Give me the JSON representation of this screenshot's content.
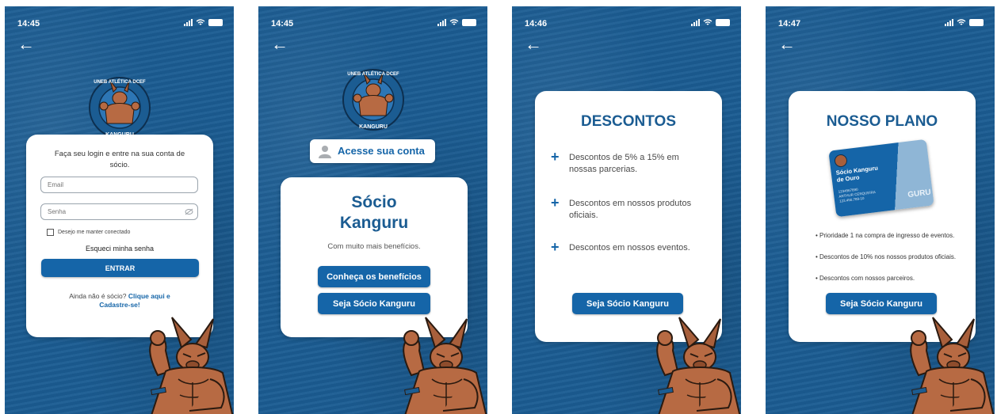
{
  "screens": [
    {
      "time": "14:45",
      "login": {
        "intro": "Faça seu login e entre na sua conta de sócio.",
        "email_placeholder": "Email",
        "password_placeholder": "Senha",
        "remember_label": "Desejo me manter conectado",
        "forgot_label": "Esqueci minha senha",
        "enter_label": "ENTRAR",
        "signup_prefix": "Ainda não é sócio?",
        "signup_link": "Clique aqui e Cadastre-se!"
      }
    },
    {
      "time": "14:45",
      "account_button": "Acesse sua conta",
      "title_line1": "Sócio",
      "title_line2": "Kanguru",
      "subtitle": "Com muito mais benefícios.",
      "benefits_button": "Conheça os benefícios",
      "join_button": "Seja Sócio Kanguru"
    },
    {
      "time": "14:46",
      "title": "DESCONTOS",
      "items": [
        "Descontos de 5% a 15% em nossas parcerias.",
        "Descontos em nossos produtos oficiais.",
        "Descontos em nossos eventos."
      ],
      "join_button": "Seja Sócio Kanguru"
    },
    {
      "time": "14:47",
      "title": "NOSSO PLANO",
      "member_card": {
        "name_line1": "Sócio Kanguru",
        "name_line2": "de Ouro",
        "number": "1234567890",
        "holder": "ARTHUR CERQUEIRA",
        "code": "123.456.789-10",
        "brand": "GURU"
      },
      "bullets": [
        "Prioridade 1 na compra de ingresso de eventos.",
        "Descontos de 10% nos nossos produtos oficiais.",
        "Descontos com nossos parceiros."
      ],
      "join_button": "Seja Sócio Kanguru"
    }
  ],
  "logo": {
    "top_text": "UNEB ATLÉTICA DCEF",
    "bottom_text": "KANGURU"
  },
  "colors": {
    "background": "#1b5c92",
    "button": "#1565a8",
    "title": "#1b5c92",
    "card": "#ffffff"
  },
  "icons": [
    "back-arrow-icon",
    "signal-icon",
    "wifi-icon",
    "battery-icon",
    "user-icon",
    "eye-off-icon",
    "plus-icon",
    "checkbox-icon"
  ]
}
